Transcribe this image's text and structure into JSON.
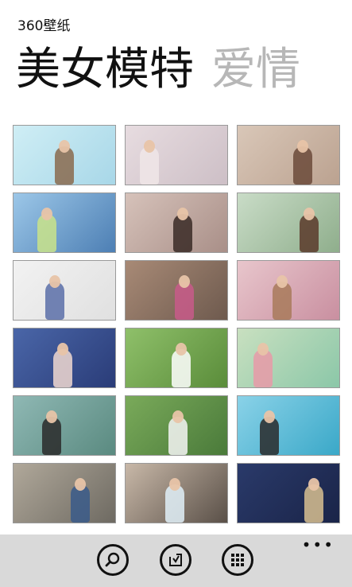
{
  "app": {
    "title": "360壁纸"
  },
  "pivot": [
    {
      "label": "美女模特",
      "active": true
    },
    {
      "label": "爱情",
      "active": false
    }
  ],
  "thumbnails": [
    {
      "colors": [
        "#cfeef5",
        "#a8d7e8"
      ],
      "accent": "#8a6a4e"
    },
    {
      "colors": [
        "#e7dce0",
        "#cdbfc6"
      ],
      "accent": "#f0e6e8"
    },
    {
      "colors": [
        "#d9c7b8",
        "#bba290"
      ],
      "accent": "#6b4a3a"
    },
    {
      "colors": [
        "#9cc7e8",
        "#4d7fb4"
      ],
      "accent": "#c9e38a"
    },
    {
      "colors": [
        "#d6c2ba",
        "#a98f88"
      ],
      "accent": "#3a2a26"
    },
    {
      "colors": [
        "#c9dcc7",
        "#8fae8c"
      ],
      "accent": "#5a3a2a"
    },
    {
      "colors": [
        "#f2f2f2",
        "#e0e0e0"
      ],
      "accent": "#5a6ea8"
    },
    {
      "colors": [
        "#a88a76",
        "#6e5a4e"
      ],
      "accent": "#c85a8a"
    },
    {
      "colors": [
        "#e8c6cc",
        "#c98fa0"
      ],
      "accent": "#a87a5a"
    },
    {
      "colors": [
        "#4a66a8",
        "#2a3c78"
      ],
      "accent": "#f0d8d0"
    },
    {
      "colors": [
        "#8fc06a",
        "#5a8c3a"
      ],
      "accent": "#ffffff"
    },
    {
      "colors": [
        "#c9e0c0",
        "#8bc7a8"
      ],
      "accent": "#e89aa8"
    },
    {
      "colors": [
        "#8fb8b4",
        "#5a8a80"
      ],
      "accent": "#2a2a2a"
    },
    {
      "colors": [
        "#7aaa5a",
        "#4a7a3a"
      ],
      "accent": "#f5f5f5"
    },
    {
      "colors": [
        "#8ad2e8",
        "#3aa8c8"
      ],
      "accent": "#2a2a2a"
    },
    {
      "colors": [
        "#b0a89a",
        "#6e6a62"
      ],
      "accent": "#3a5a8a"
    },
    {
      "colors": [
        "#c8b8a8",
        "#5a5048"
      ],
      "accent": "#e0f0f8"
    },
    {
      "colors": [
        "#2a3a6a",
        "#1a2448"
      ],
      "accent": "#d8c090"
    }
  ],
  "appbar": {
    "buttons": [
      {
        "name": "search-button",
        "icon": "search-icon"
      },
      {
        "name": "download-button",
        "icon": "download-icon"
      },
      {
        "name": "categories-button",
        "icon": "grid-icon"
      }
    ],
    "more": "•••"
  }
}
